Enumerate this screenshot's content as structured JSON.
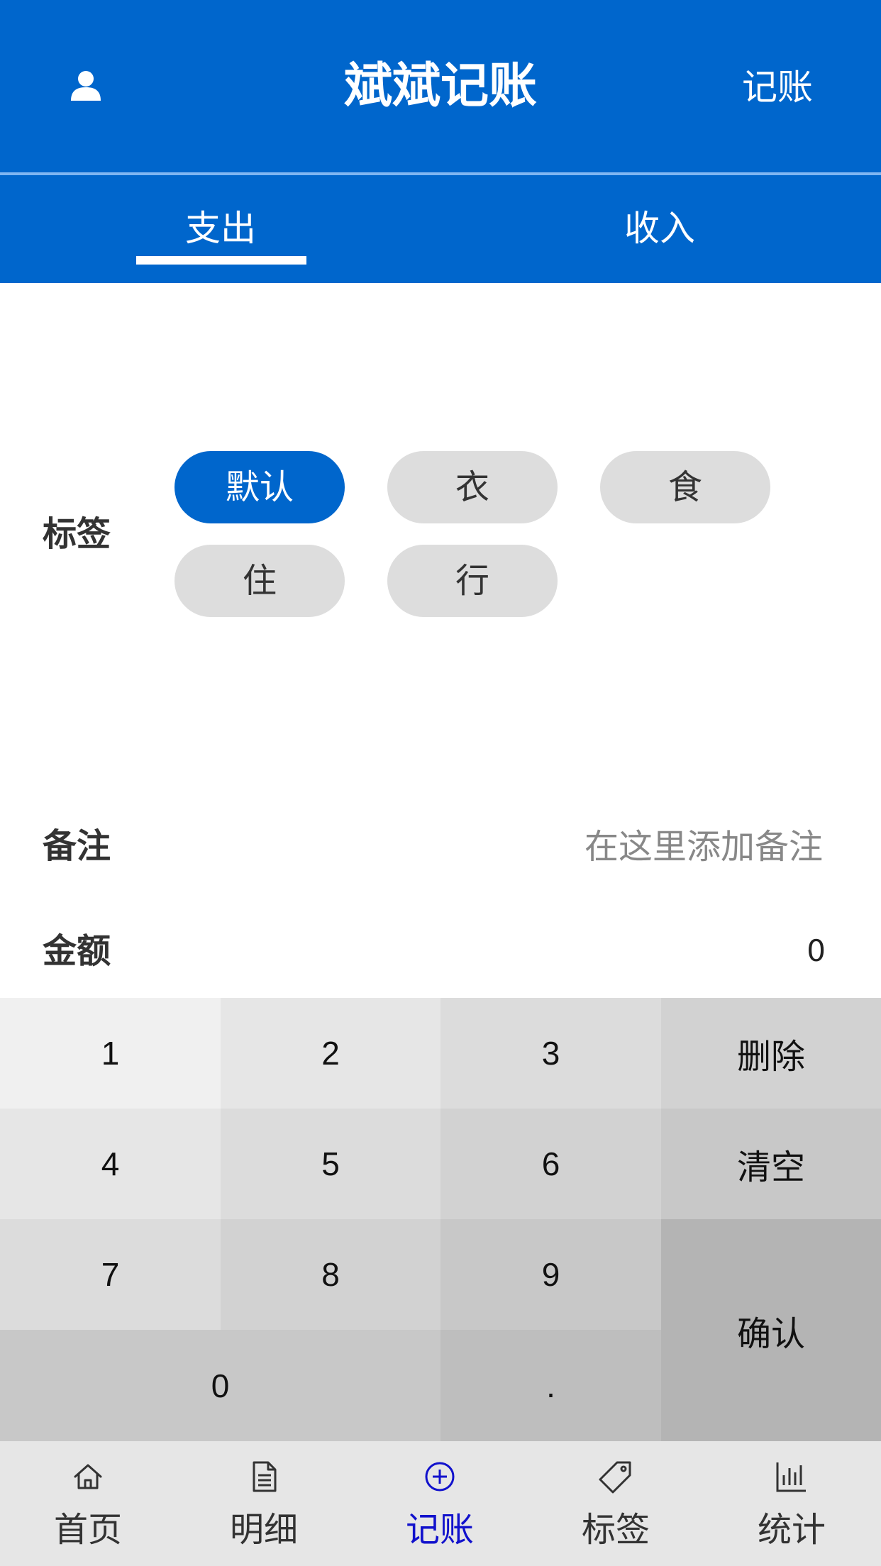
{
  "header": {
    "title": "斌斌记账",
    "right_link": "记账",
    "tabs": [
      {
        "label": "支出",
        "active": true
      },
      {
        "label": "收入",
        "active": false
      }
    ]
  },
  "tags": {
    "label": "标签",
    "items": [
      {
        "label": "默认",
        "selected": true
      },
      {
        "label": "衣",
        "selected": false
      },
      {
        "label": "食",
        "selected": false
      },
      {
        "label": "住",
        "selected": false
      },
      {
        "label": "行",
        "selected": false
      }
    ]
  },
  "note": {
    "label": "备注",
    "placeholder": "在这里添加备注",
    "value": ""
  },
  "amount": {
    "label": "金额",
    "value": "0"
  },
  "keypad": {
    "k1": "1",
    "k2": "2",
    "k3": "3",
    "delete": "删除",
    "k4": "4",
    "k5": "5",
    "k6": "6",
    "clear": "清空",
    "k7": "7",
    "k8": "8",
    "k9": "9",
    "confirm": "确认",
    "k0": "0",
    "dot": "."
  },
  "bottom_nav": {
    "items": [
      {
        "label": "首页",
        "icon": "home-icon",
        "active": false
      },
      {
        "label": "明细",
        "icon": "document-icon",
        "active": false
      },
      {
        "label": "记账",
        "icon": "plus-circle-icon",
        "active": true
      },
      {
        "label": "标签",
        "icon": "tag-icon",
        "active": false
      },
      {
        "label": "统计",
        "icon": "chart-icon",
        "active": false
      }
    ]
  },
  "colors": {
    "primary": "#0066cc",
    "active_nav": "#1111cc",
    "tag_bg": "#dddddd"
  }
}
